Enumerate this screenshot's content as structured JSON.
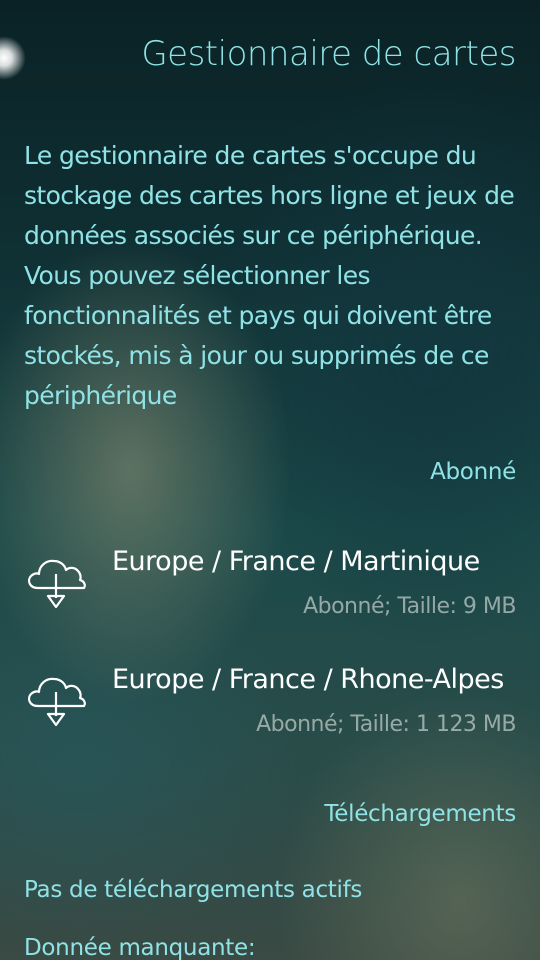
{
  "header": {
    "title": "Gestionnaire de cartes"
  },
  "description": "Le gestionnaire de cartes s'occupe du stockage des cartes hors ligne et jeux de données associés sur ce périphérique. Vous pouvez sélectionner les fonctionnalités et pays qui doivent être stockés, mis à jour ou supprimés de ce périphérique",
  "subscribed": {
    "header": "Abonné",
    "items": [
      {
        "title": "Europe / France / Martinique",
        "status": "Abonné; Taille: 9 MB",
        "icon": "cloud-download-icon"
      },
      {
        "title": "Europe / France / Rhone-Alpes",
        "status": "Abonné; Taille: 1 123 MB",
        "icon": "cloud-download-icon"
      }
    ]
  },
  "downloads": {
    "header": "Téléchargements",
    "status": "Pas de téléchargements actifs",
    "missing_label": "Donnée manquante:"
  },
  "colors": {
    "highlight": "#8fe3e6",
    "primary_text": "#ffffff",
    "secondary_text": "#b4c3bd"
  }
}
